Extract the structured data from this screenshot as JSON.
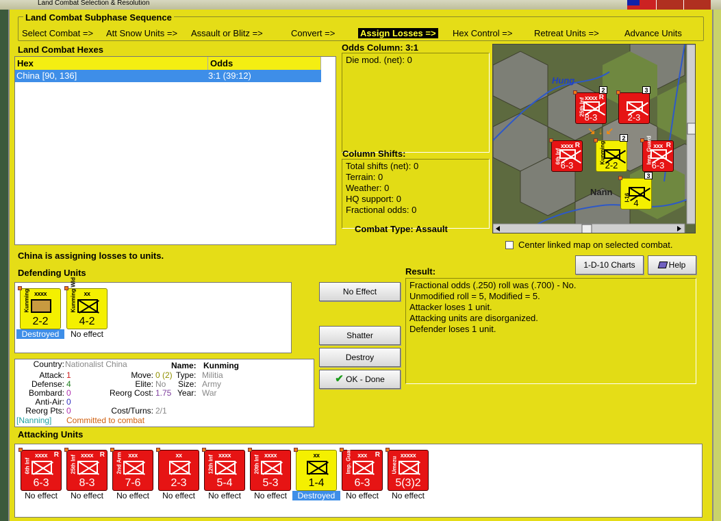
{
  "window": {
    "title": "Land Combat Selection & Resolution"
  },
  "sequence": {
    "title": "Land Combat Subphase Sequence",
    "steps": [
      "Select Combat =>",
      "Att Snow Units =>",
      "Assault or Blitz =>",
      "Convert =>",
      "Assign Losses =>",
      "Hex Control =>",
      "Retreat Units =>",
      "Advance Units"
    ],
    "active_index": 4
  },
  "hexes": {
    "title": "Land Combat Hexes",
    "columns": [
      "Hex",
      "Odds"
    ],
    "rows": [
      {
        "hex": "China [90, 136]",
        "odds": "3:1 (39:12)"
      }
    ]
  },
  "odds": {
    "title": "Odds Column: 3:1",
    "die_mod": "Die mod. (net): 0"
  },
  "shifts": {
    "title": "Column Shifts:",
    "lines": [
      "Total shifts (net): 0",
      "Terrain: 0",
      "Weather: 0",
      "HQ support: 0",
      "Fractional odds: 0"
    ]
  },
  "combat_type": {
    "label": "Combat Type:",
    "value": "Assault"
  },
  "map": {
    "labels": {
      "hung": "Hung",
      "nann": "Nann"
    },
    "scroll_position": 0.5
  },
  "center_map": {
    "label": "Center linked map on selected combat.",
    "checked": false
  },
  "buttons": {
    "charts": "1-D-10 Charts",
    "help": "Help",
    "no_effect": "No Effect",
    "shatter": "Shatter",
    "destroy": "Destroy",
    "ok_done": "OK - Done"
  },
  "message": "China is assigning losses to units.",
  "defending": {
    "title": "Defending Units",
    "units": [
      {
        "size": "xxxx",
        "name": "Kunming",
        "strength": "2-2",
        "type": "militia",
        "status": "Destroyed",
        "selected": true
      },
      {
        "size": "xx",
        "name": "Kunming Wld",
        "strength": "4-2",
        "type": "warlord",
        "status": "No effect",
        "selected": false
      }
    ]
  },
  "info": {
    "country_label": "Country:",
    "country": "Nationalist China",
    "name_label": "Name:",
    "name": "Kunming",
    "attack_label": "Attack:",
    "attack": "1",
    "move_label": "Move:",
    "move": "0 (2)",
    "type_label": "Type:",
    "type": "Militia",
    "defense_label": "Defense:",
    "defense": "4",
    "elite_label": "Elite:",
    "elite": "No",
    "size_label": "Size:",
    "size": "Army",
    "bombard_label": "Bombard:",
    "bombard": "0",
    "reorg_cost_label": "Reorg Cost:",
    "reorg_cost": "1.75",
    "year_label": "Year:",
    "year": "War",
    "antiair_label": "Anti-Air:",
    "antiair": "0",
    "reorg_pts_label": "Reorg Pts:",
    "reorg_pts": "0",
    "cost_turns_label": "Cost/Turns:",
    "cost_turns": "2/1",
    "location": "[Nanning]",
    "commit": "Committed to combat"
  },
  "result": {
    "title": "Result:",
    "lines": [
      "Fractional odds (.250) roll was (.700)  - No.",
      "Unmodified roll = 5, Modified = 5.",
      "Attacker loses 1 unit.",
      "Attacking units are disorganized.",
      "Defender loses 1 unit."
    ]
  },
  "attacking": {
    "title": "Attacking Units",
    "units": [
      {
        "size": "xxxx",
        "name": "6th Inf",
        "strength": "6-3",
        "rtag": "R",
        "status": "No effect",
        "selected": false,
        "color": "red"
      },
      {
        "size": "xxxx",
        "name": "25th Inf",
        "strength": "8-3",
        "rtag": "R",
        "status": "No effect",
        "selected": false,
        "color": "red"
      },
      {
        "size": "xxx",
        "name": "2nd Arm",
        "strength": "7-6",
        "rtag": "",
        "status": "No effect",
        "selected": false,
        "color": "red"
      },
      {
        "size": "xx",
        "name": "",
        "strength": "2-3",
        "rtag": "",
        "status": "No effect",
        "selected": false,
        "color": "red"
      },
      {
        "size": "xxxx",
        "name": "12th Inf",
        "strength": "5-4",
        "rtag": "",
        "status": "No effect",
        "selected": false,
        "color": "red"
      },
      {
        "size": "xxxx",
        "name": "20th Inf",
        "strength": "5-3",
        "rtag": "",
        "status": "No effect",
        "selected": false,
        "color": "red"
      },
      {
        "size": "xx",
        "name": "",
        "strength": "1-4",
        "rtag": "",
        "status": "Destroyed",
        "selected": true,
        "color": "yellow"
      },
      {
        "size": "xxx",
        "name": "Imp. Guard",
        "strength": "6-3",
        "rtag": "R",
        "status": "No effect",
        "selected": false,
        "color": "red"
      },
      {
        "size": "xxxxx",
        "name": "Umezu",
        "strength": "5(3)2",
        "rtag": "",
        "status": "No effect",
        "selected": false,
        "color": "red"
      }
    ]
  },
  "map_counters": [
    {
      "size": "xxxx",
      "name": "25th Inf",
      "strength": "8-3",
      "rtag": "R",
      "stack": "2",
      "color": "red"
    },
    {
      "size": "",
      "name": "",
      "strength": "2-3",
      "rtag": "",
      "stack": "3",
      "color": "red"
    },
    {
      "size": "xxxx",
      "name": "6th Inf",
      "strength": "6-3",
      "rtag": "R",
      "stack": "",
      "color": "red"
    },
    {
      "size": "",
      "name": "Kunming",
      "strength": "2-2",
      "rtag": "",
      "stack": "2",
      "color": "yellow"
    },
    {
      "size": "xxx",
      "name": "Imp. Guard",
      "strength": "6-3",
      "rtag": "R",
      "stack": "",
      "color": "red"
    },
    {
      "size": "",
      "name": "I-16",
      "strength": "4",
      "rtag": "",
      "stack": "3",
      "color": "yellow"
    }
  ],
  "map_stack_badge": "2",
  "colors": {
    "panel": "#e5dd17",
    "selection": "#3e8ee8",
    "unit_red": "#e61414",
    "unit_yellow": "#f4f000",
    "strength_red": "#cc2020",
    "strength_green": "#208020",
    "value_blue": "#3030c0"
  }
}
